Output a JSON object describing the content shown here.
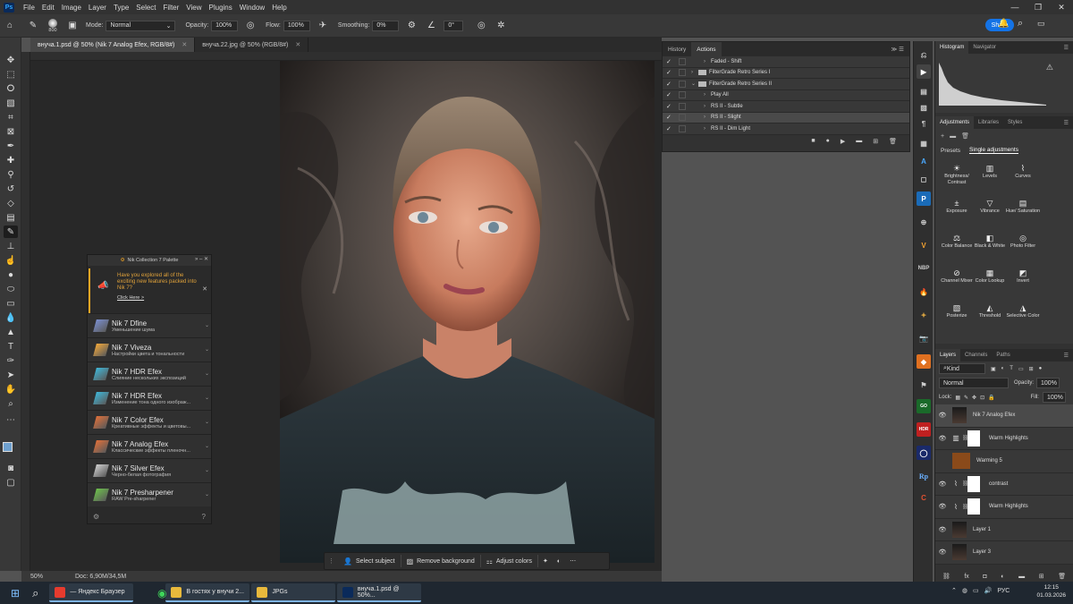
{
  "menubar": {
    "logo": "Ps",
    "items": [
      "File",
      "Edit",
      "Image",
      "Layer",
      "Type",
      "Select",
      "Filter",
      "View",
      "Plugins",
      "Window",
      "Help"
    ]
  },
  "options": {
    "brush_size": "800",
    "mode_label": "Mode:",
    "mode_value": "Normal",
    "opacity_label": "Opacity:",
    "opacity_value": "100%",
    "flow_label": "Flow:",
    "flow_value": "100%",
    "smoothing_label": "Smoothing:",
    "smoothing_value": "0%",
    "angle_value": "0°",
    "share_label": "Share"
  },
  "tabs": [
    {
      "label": "внуча.1.psd @ 50% (Nik 7 Analog Efex, RGB/8#)",
      "active": true
    },
    {
      "label": "внуча.22.jpg @ 50% (RGB/8#)",
      "active": false
    }
  ],
  "status": {
    "zoom": "50%",
    "doc": "Doc: 6,90M/34,5M"
  },
  "nik_palette": {
    "title": "Nik Collection 7 Palette",
    "promo_text": "Have you explored all of the exciting new features packed into Nik 7?",
    "promo_link": "Click Here >",
    "items": [
      {
        "name": "Nik 7 Dfine",
        "desc": "Уменьшение шума",
        "color": "#7a8fcf"
      },
      {
        "name": "Nik 7 Viveza",
        "desc": "Настройки цвета и тональности",
        "color": "#f2a83b"
      },
      {
        "name": "Nik 7 HDR Efex",
        "desc": "Слияние нескольких экспозиций",
        "color": "#3fb7d8"
      },
      {
        "name": "Nik 7 HDR Efex",
        "desc": "Изменение тона одного изображ...",
        "color": "#3fb7d8"
      },
      {
        "name": "Nik 7 Color Efex",
        "desc": "Креативные эффекты и цветовы...",
        "color": "#e0703a"
      },
      {
        "name": "Nik 7 Analog Efex",
        "desc": "Классические эффекты пленочн...",
        "color": "#e0703a"
      },
      {
        "name": "Nik 7 Silver Efex",
        "desc": "Черно-белая фотография",
        "color": "#cfcfcf"
      },
      {
        "name": "Nik 7 Presharpener",
        "desc": "RAW Pre-sharpener",
        "color": "#6dc24b"
      }
    ]
  },
  "context_bar": {
    "select_subject": "Select subject",
    "remove_background": "Remove background",
    "adjust_colors": "Adjust colors"
  },
  "actions_panel": {
    "tab_history": "History",
    "tab_actions": "Actions",
    "rows": [
      {
        "label": "Faded - Shift",
        "type": "action",
        "indent": 1,
        "highlight": false
      },
      {
        "label": "FilterGrade Retro Series I",
        "type": "set",
        "indent": 0,
        "highlight": false
      },
      {
        "label": "FilterGrade Retro Series II",
        "type": "set-open",
        "indent": 0,
        "highlight": false
      },
      {
        "label": "Play All",
        "type": "action",
        "indent": 1,
        "highlight": false
      },
      {
        "label": "RS II - Subtle",
        "type": "action",
        "indent": 1,
        "highlight": false
      },
      {
        "label": "RS II - Slight",
        "type": "action",
        "indent": 1,
        "highlight": true
      },
      {
        "label": "RS II - Dim Light",
        "type": "action",
        "indent": 1,
        "highlight": false
      }
    ]
  },
  "right_panel": {
    "tab_histogram": "Histogram",
    "tab_navigator": "Navigator",
    "tab_adjustments": "Adjustments",
    "tab_libraries": "Libraries",
    "tab_styles": "Styles",
    "presets_label": "Presets",
    "single_adj_label": "Single adjustments",
    "adjustments": [
      "Brightness/ Contrast",
      "Levels",
      "Curves",
      "Exposure",
      "Vibrance",
      "Hue/ Saturation",
      "Color Balance",
      "Black & White",
      "Photo Filter",
      "Channel Mixer",
      "Color Lookup",
      "Invert",
      "Posterize",
      "Threshold",
      "Selective Color"
    ],
    "tab_layers": "Layers",
    "tab_channels": "Channels",
    "tab_paths": "Paths",
    "kind_label": "Kind",
    "blend_mode": "Normal",
    "opacity_label": "Opacity:",
    "opacity_value": "100%",
    "lock_label": "Lock:",
    "fill_label": "Fill:",
    "fill_value": "100%",
    "layers": [
      {
        "name": "Nik 7 Analog Efex",
        "kind": "pixel",
        "visible": true,
        "selected": true
      },
      {
        "name": "Warm Highlights",
        "kind": "levels",
        "visible": true,
        "selected": false
      },
      {
        "name": "Warming 5",
        "kind": "fill",
        "visible": false,
        "selected": false
      },
      {
        "name": "contrast",
        "kind": "curves",
        "visible": true,
        "selected": false
      },
      {
        "name": "Warm Highlights",
        "kind": "curves",
        "visible": true,
        "selected": false
      },
      {
        "name": "Layer 1",
        "kind": "pixel",
        "visible": true,
        "selected": false
      },
      {
        "name": "Layer 3",
        "kind": "pixel",
        "visible": true,
        "selected": false
      }
    ]
  },
  "taskbar": {
    "apps": [
      {
        "label": "— Яндекс Браузер",
        "color": "#e63b2e"
      },
      {
        "label": "В гостях у внучи 2...",
        "color": "#e8b93c"
      },
      {
        "label": "JPGs",
        "color": "#e8b93c"
      },
      {
        "label": "внуча.1.psd @ 50%...",
        "color": "#0a2a5a"
      }
    ],
    "lang": "РУС",
    "time": "12:15",
    "date": "01.03.2026"
  }
}
